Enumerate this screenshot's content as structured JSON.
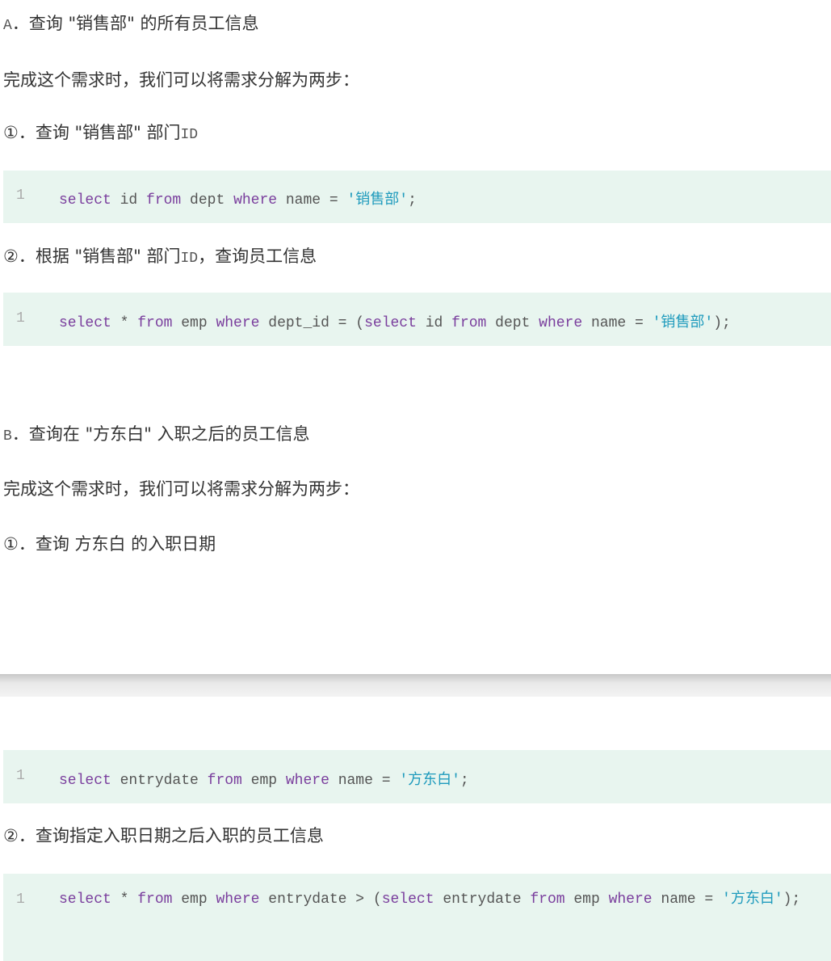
{
  "section_a": {
    "label": "A",
    "title": "．查询 \"销售部\" 的所有员工信息",
    "intro": "完成这个需求时，我们可以将需求分解为两步：",
    "step1_text": "①．查询 \"销售部\" 部门",
    "step1_suffix": "ID",
    "code1": {
      "line_no": "1",
      "parts": [
        "select",
        " id ",
        "from",
        " dept ",
        "where",
        " name = ",
        "'销售部'",
        ";"
      ]
    },
    "step2_text": "②．根据 \"销售部\" 部门",
    "step2_id": "ID",
    "step2_tail": "，查询员工信息",
    "code2": {
      "line_no": "1",
      "parts": [
        "select",
        " * ",
        "from",
        " emp ",
        "where",
        " dept_id = (",
        "select",
        " id ",
        "from",
        " dept ",
        "where",
        " name = ",
        "'销售部'",
        ");"
      ]
    }
  },
  "section_b": {
    "label": "B",
    "title": "．查询在 \"方东白\" 入职之后的员工信息",
    "intro": "完成这个需求时，我们可以将需求分解为两步：",
    "step1_text": "①．查询 方东白 的入职日期",
    "code1": {
      "line_no": "1",
      "parts": [
        "select",
        " entrydate ",
        "from",
        " emp ",
        "where",
        " name = ",
        "'方东白'",
        ";"
      ]
    },
    "step2_text": "②．查询指定入职日期之后入职的员工信息",
    "code2": {
      "line_no": "1",
      "parts": [
        "select",
        " * ",
        "from",
        " emp ",
        "where",
        " entrydate > (",
        "select",
        " entrydate ",
        "from",
        " emp ",
        "where",
        " name = ",
        "'方东白'",
        ");"
      ]
    }
  }
}
